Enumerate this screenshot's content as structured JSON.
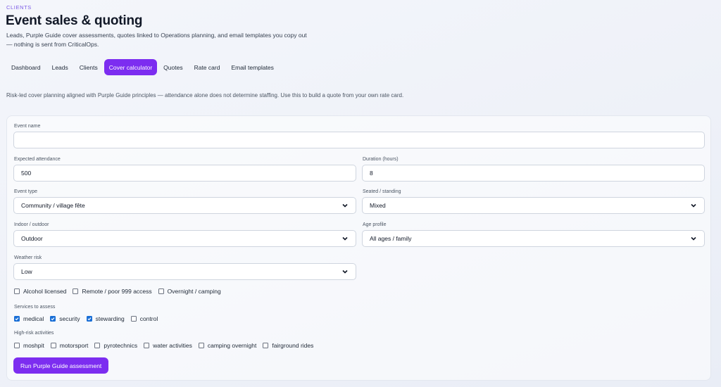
{
  "header": {
    "eyebrow": "CLIENTS",
    "title": "Event sales & quoting",
    "subtitle": "Leads, Purple Guide cover assessments, quotes linked to Operations planning, and email templates you copy out — nothing is sent from CriticalOps."
  },
  "tabs": [
    {
      "label": "Dashboard",
      "active": false
    },
    {
      "label": "Leads",
      "active": false
    },
    {
      "label": "Clients",
      "active": false
    },
    {
      "label": "Cover calculator",
      "active": true
    },
    {
      "label": "Quotes",
      "active": false
    },
    {
      "label": "Rate card",
      "active": false
    },
    {
      "label": "Email templates",
      "active": false
    }
  ],
  "intro": "Risk-led cover planning aligned with Purple Guide principles — attendance alone does not determine staffing. Use this to build a quote from your own rate card.",
  "form": {
    "event_name": {
      "label": "Event name",
      "value": ""
    },
    "attendance": {
      "label": "Expected attendance",
      "value": "500"
    },
    "duration": {
      "label": "Duration (hours)",
      "value": "8"
    },
    "event_type": {
      "label": "Event type",
      "value": "Community / village fête"
    },
    "seating": {
      "label": "Seated / standing",
      "value": "Mixed"
    },
    "indoor_outdoor": {
      "label": "Indoor / outdoor",
      "value": "Outdoor"
    },
    "age_profile": {
      "label": "Age profile",
      "value": "All ages / family"
    },
    "weather_risk": {
      "label": "Weather risk",
      "value": "Low"
    },
    "flags": [
      {
        "label": "Alcohol licensed",
        "checked": false
      },
      {
        "label": "Remote / poor 999 access",
        "checked": false
      },
      {
        "label": "Overnight / camping",
        "checked": false
      }
    ],
    "services_label": "Services to assess",
    "services": [
      {
        "label": "medical",
        "checked": true
      },
      {
        "label": "security",
        "checked": true
      },
      {
        "label": "stewarding",
        "checked": true
      },
      {
        "label": "control",
        "checked": false
      }
    ],
    "activities_label": "High-risk activities",
    "activities": [
      {
        "label": "moshpit",
        "checked": false
      },
      {
        "label": "motorsport",
        "checked": false
      },
      {
        "label": "pyrotechnics",
        "checked": false
      },
      {
        "label": "water activities",
        "checked": false
      },
      {
        "label": "camping overnight",
        "checked": false
      },
      {
        "label": "fairground rides",
        "checked": false
      }
    ],
    "run_button": "Run Purple Guide assessment"
  },
  "colors": {
    "accent": "#7c2df0",
    "checkbox": "#1a6fd6",
    "eyebrow": "#7c5ce6"
  }
}
